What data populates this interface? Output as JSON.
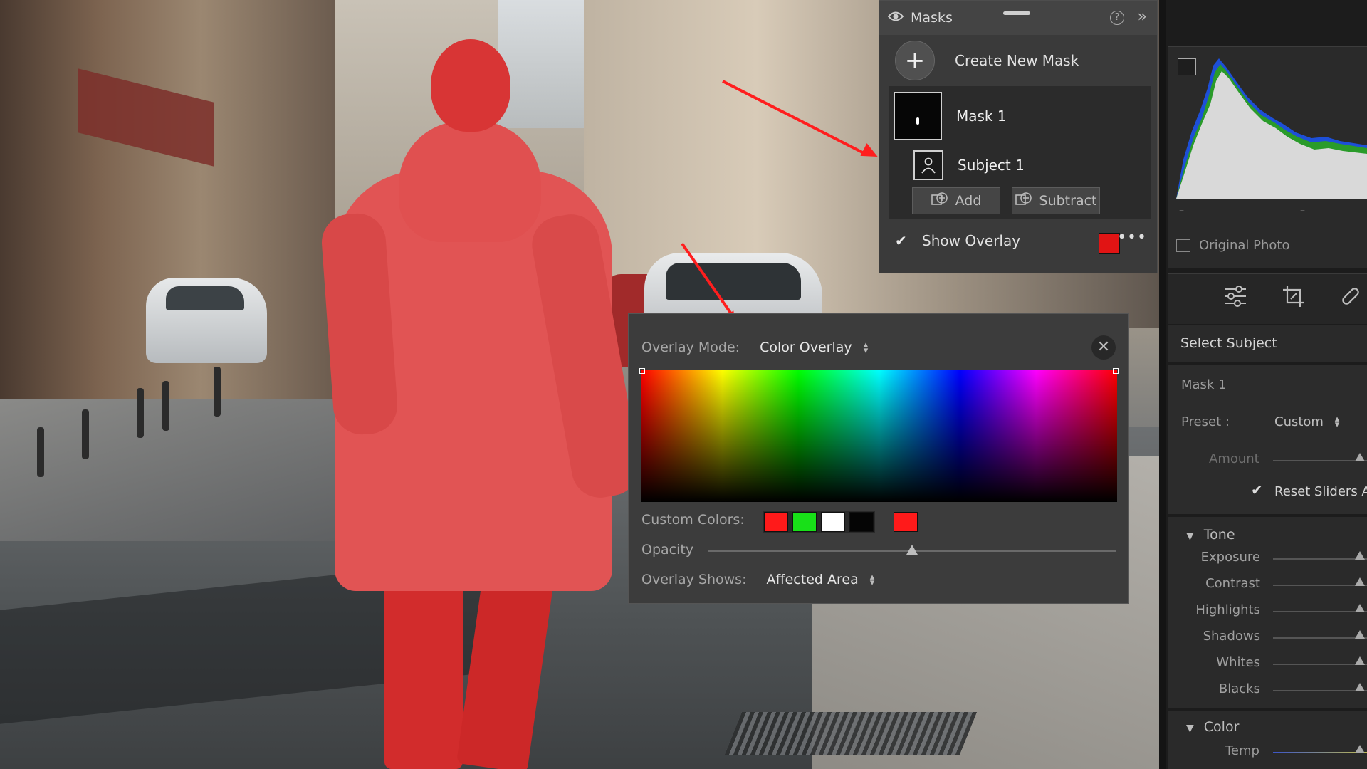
{
  "masks_panel": {
    "title": "Masks",
    "help": "?",
    "collapse": "»",
    "create_new_mask": "Create New Mask",
    "mask_name": "Mask 1",
    "subject_name": "Subject 1",
    "add_label": "Add",
    "subtract_label": "Subtract",
    "show_overlay_label": "Show Overlay",
    "show_overlay_checked": true,
    "overlay_color": "#e11414"
  },
  "overlay_popup": {
    "mode_label": "Overlay Mode:",
    "mode_value": "Color Overlay",
    "custom_colors_label": "Custom Colors:",
    "custom_colors": [
      "#ff1a1a",
      "#18e018",
      "#ffffff",
      "#050505"
    ],
    "selected_color": "#ff1a1a",
    "opacity_label": "Opacity",
    "opacity_value": 0.5,
    "overlay_shows_label": "Overlay Shows:",
    "overlay_shows_value": "Affected Area"
  },
  "right_panel": {
    "original_photo_label": "Original Photo",
    "select_subject": "Select Subject",
    "mask_title": "Mask 1",
    "preset_label": "Preset :",
    "preset_value": "Custom",
    "amount_label": "Amount",
    "reset_sliders_label": "Reset Sliders A",
    "reset_sliders_checked": true,
    "tone_header": "Tone",
    "tone_sliders": [
      "Exposure",
      "Contrast",
      "Highlights",
      "Shadows",
      "Whites",
      "Blacks"
    ],
    "color_header": "Color",
    "temp_label": "Temp",
    "hist_ticks": [
      "–",
      "–"
    ]
  },
  "icons": [
    "eye-icon",
    "plus-icon",
    "person-icon",
    "add-mask-icon",
    "subtract-mask-icon",
    "sliders-icon",
    "crop-icon",
    "heal-icon",
    "close-icon"
  ]
}
